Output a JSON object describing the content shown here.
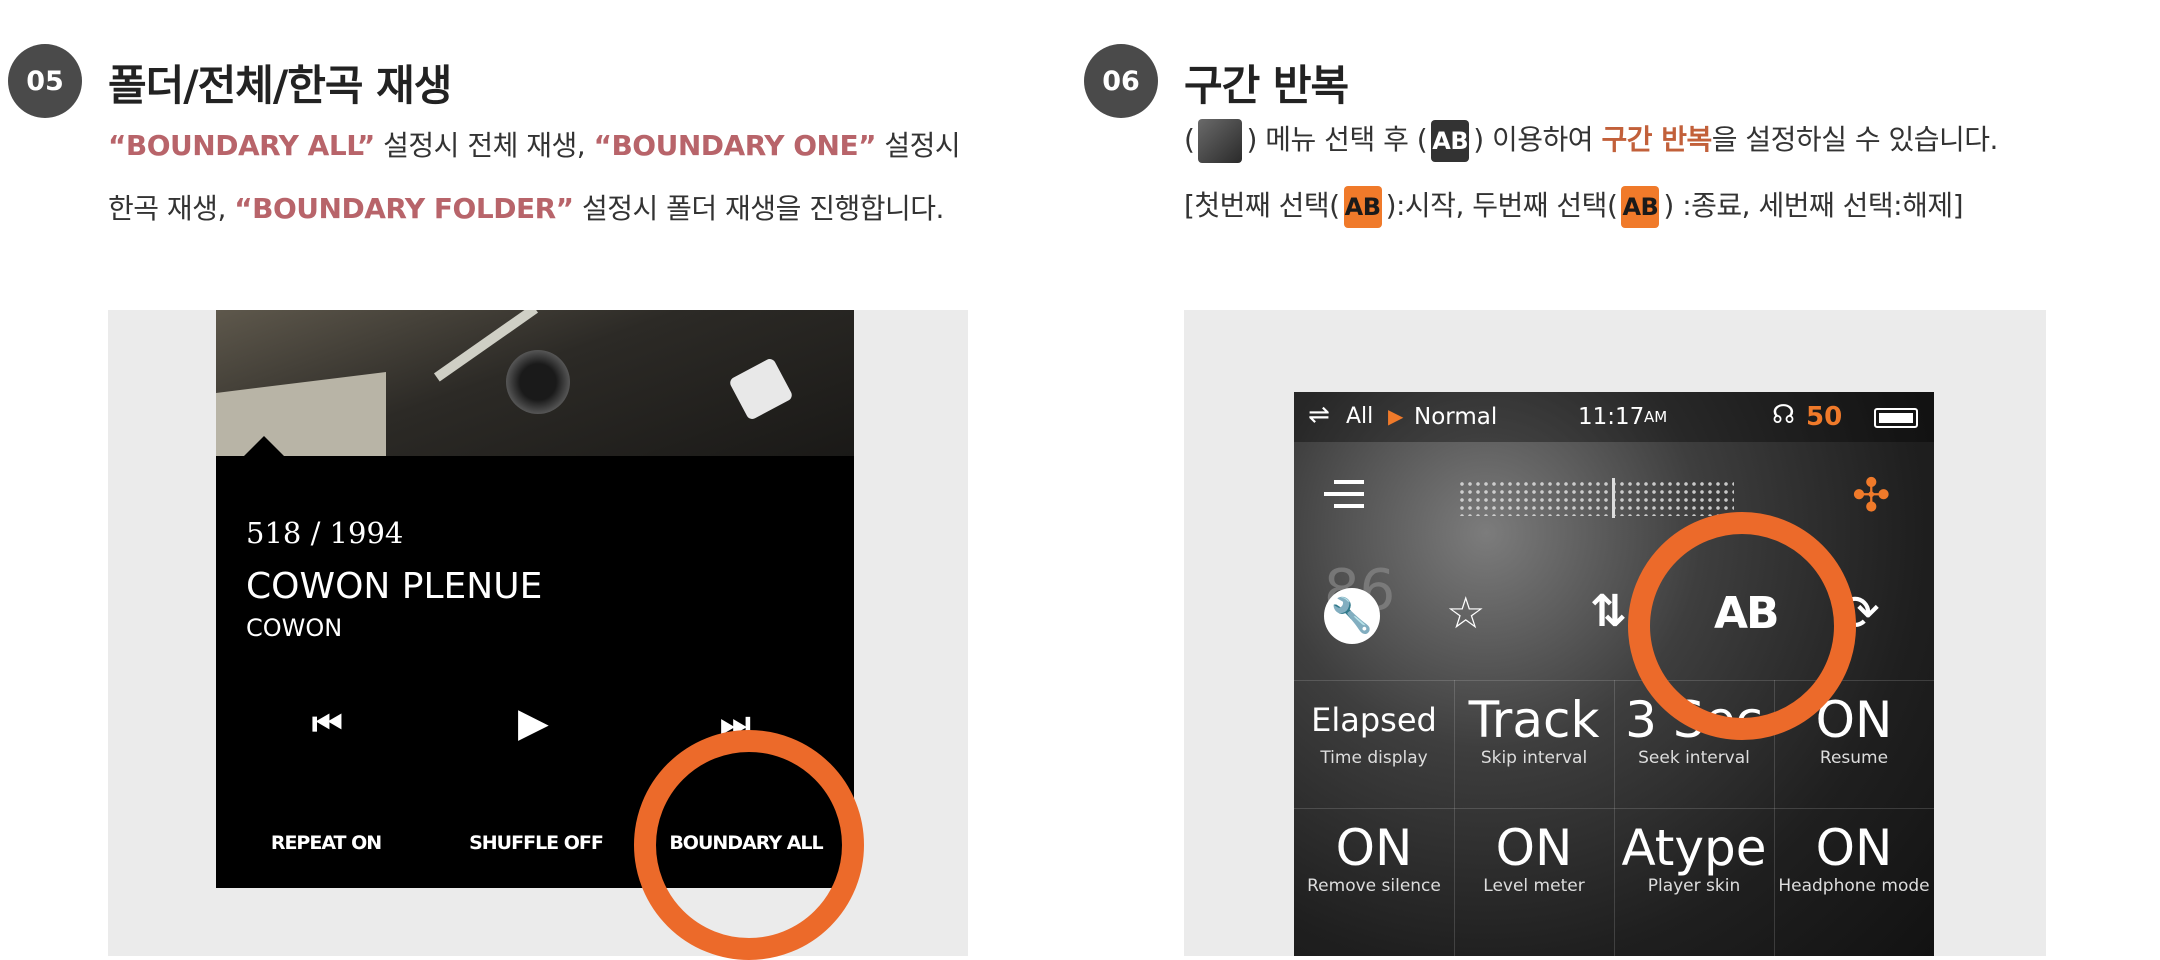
{
  "section5": {
    "number": "05",
    "title": "폴더/전체/한곡 재생",
    "line1": {
      "q1": "“BOUNDARY ALL”",
      "t1": " 설정시 전체 재생, ",
      "q2": "“BOUNDARY ONE”",
      "t2": " 설정시"
    },
    "line2": {
      "t1": "한곡 재생, ",
      "q1": "“BOUNDARY FOLDER”",
      "t2": " 설정시 폴더 재생을 진행합니다."
    },
    "player": {
      "track_count": "518 / 1994",
      "title": "COWON PLENUE",
      "artist": "COWON",
      "buttons": [
        "REPEAT ON",
        "SHUFFLE OFF",
        "BOUNDARY ALL"
      ],
      "highlight_color": "#ec6a2a"
    }
  },
  "section6": {
    "number": "06",
    "title": "구간 반복",
    "line1": {
      "p_open": "(",
      "t1": ") 메뉴 선택 후 (",
      "t2": ") 이용하여 ",
      "hl": "구간 반복",
      "t3": "을 설정하실 수 있습니다."
    },
    "line2": {
      "t1": "[첫번째 선택(",
      "t2": "):시작, 두번째 선택(",
      "t3": ") :종료, 세번째 선택:해제]"
    },
    "ab_icon": "AB",
    "player": {
      "status": {
        "repeat": "All",
        "mode": "Normal",
        "time": "11:17",
        "ampm": "AM",
        "volume": "50"
      },
      "icon_row_label": "AB",
      "icon_row_number": "86",
      "cells": [
        {
          "value": "Elapsed",
          "label": "Time display"
        },
        {
          "value": "Track",
          "label": "Skip interval"
        },
        {
          "value": "3 Sec",
          "label": "Seek interval"
        },
        {
          "value": "ON",
          "label": "Resume"
        },
        {
          "value": "ON",
          "label": "Remove silence"
        },
        {
          "value": "ON",
          "label": "Level meter"
        },
        {
          "value": "Atype",
          "label": "Player skin"
        },
        {
          "value": "ON",
          "label": "Headphone mode"
        }
      ],
      "highlight_color": "#ec6a2a",
      "accent_color": "#f07a2a"
    }
  }
}
